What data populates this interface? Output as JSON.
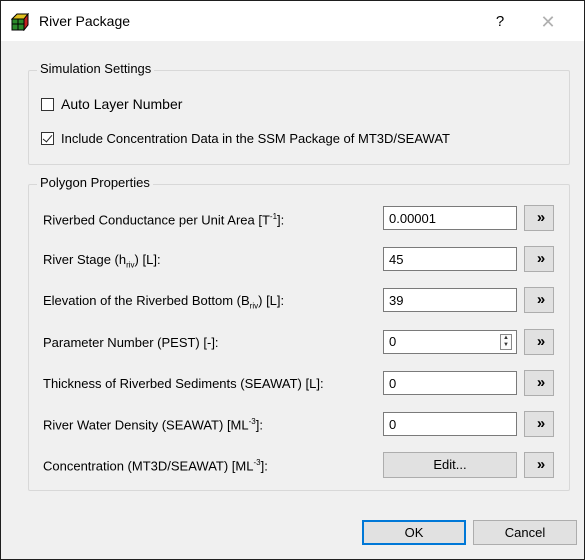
{
  "window": {
    "title": "River Package",
    "help_label": "?",
    "close_label": "✕"
  },
  "simulation": {
    "title": "Simulation Settings",
    "auto_layer": {
      "label": "Auto Layer Number",
      "checked": false
    },
    "include_conc": {
      "label": "Include Concentration Data in the SSM Package of MT3D/SEAWAT",
      "checked": true
    }
  },
  "polygon": {
    "title": "Polygon Properties",
    "rows": [
      {
        "label_pre": "Riverbed Conductance per Unit Area [T",
        "label_sup": "-1",
        "label_post": "]:",
        "value": "0.00001"
      },
      {
        "label_pre": "River Stage (h",
        "label_sub": "riv",
        "label_post": ") [L]:",
        "value": "45"
      },
      {
        "label_pre": "Elevation of the Riverbed Bottom (B",
        "label_sub": "riv",
        "label_post": ") [L]:",
        "value": "39"
      },
      {
        "label": "Parameter Number (PEST) [-]:",
        "value": "0"
      },
      {
        "label": "Thickness of Riverbed Sediments (SEAWAT) [L]:",
        "value": "0"
      },
      {
        "label_pre": "River Water Density (SEAWAT) [ML",
        "label_sup": "-3",
        "label_post": "]:",
        "value": "0"
      },
      {
        "label_pre": "Concentration (MT3D/SEAWAT) [ML",
        "label_sup": "-3",
        "label_post": "]:",
        "button": "Edit..."
      }
    ],
    "go_symbol": "»"
  },
  "buttons": {
    "ok": "OK",
    "cancel": "Cancel"
  }
}
